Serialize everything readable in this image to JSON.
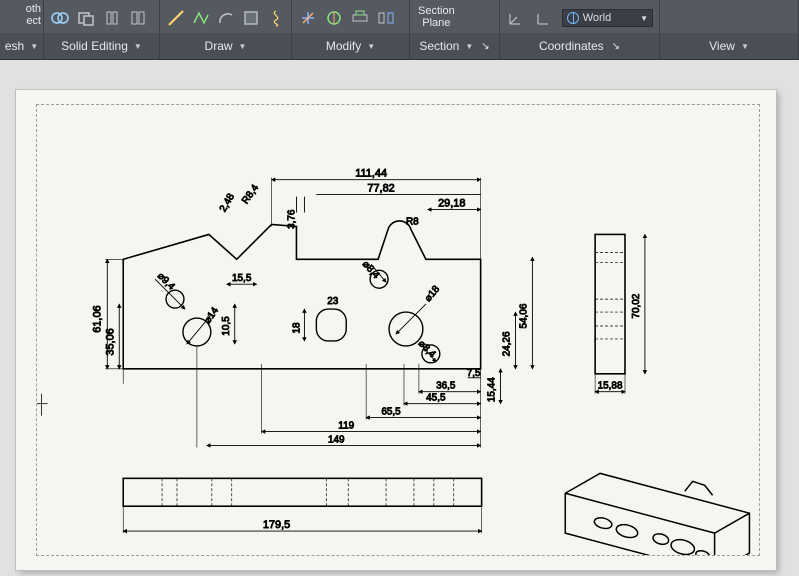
{
  "ribbon": {
    "groups": {
      "mesh": {
        "label": "esh",
        "partial_left": "oth",
        "partial_left2": "ect"
      },
      "solid_editing": {
        "label": "Solid Editing"
      },
      "draw": {
        "label": "Draw"
      },
      "modify": {
        "label": "Modify"
      },
      "section": {
        "label": "Section",
        "plane_line1": "Section",
        "plane_line2": "Plane"
      },
      "coordinates": {
        "label": "Coordinates",
        "world": "World"
      },
      "view": {
        "label": "View"
      }
    }
  },
  "drawing": {
    "dimensions": {
      "top_111_44": "111,44",
      "top_77_82": "77,82",
      "top_29_18": "29,18",
      "top_3_76": "3,76",
      "top_2_48": "2,48",
      "r8_4": "R8,4",
      "r8": "R8",
      "d9_4": "⌀9,4",
      "d14": "⌀14",
      "d18": "⌀18",
      "d23": "23",
      "d8_4_a": "⌀8,4",
      "d8_4_b": "⌀8,4",
      "h_15_5": "15,5",
      "h_10_5": "10,5",
      "h_18": "18",
      "v_61_06": "61,06",
      "v_35_06": "35,06",
      "v_54_06": "54,06",
      "v_24_26": "24,26",
      "v_15_44": "15,44",
      "v_70_02": "70,02",
      "h_7_5": "7,5",
      "h_36_5": "36,5",
      "h_45_5": "45,5",
      "h_65_5": "65,5",
      "h_119": "119",
      "h_149": "149",
      "h_179_5": "179,5",
      "h_15_88": "15,88"
    }
  }
}
